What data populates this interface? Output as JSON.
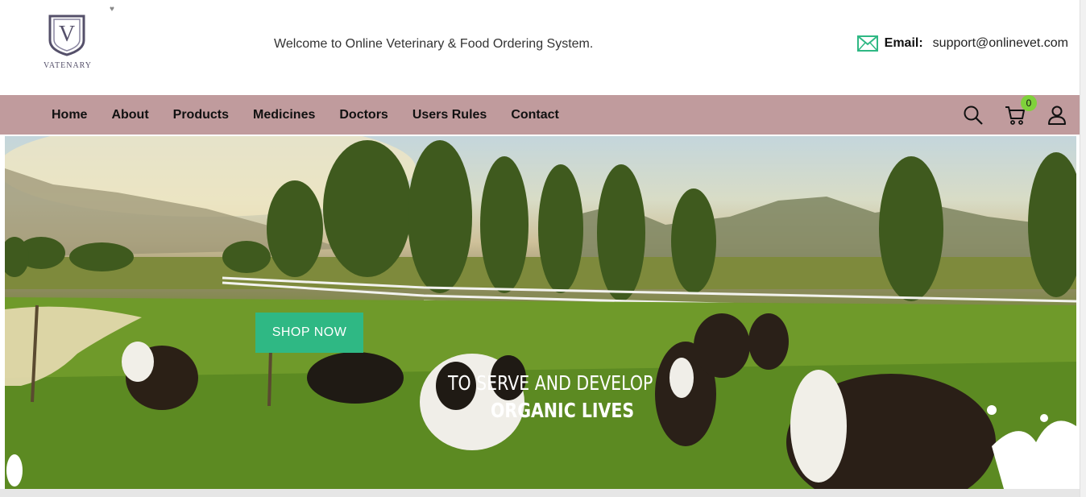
{
  "header": {
    "logo_text": "VATENARY",
    "logo_letter": "V",
    "welcome": "Welcome to Online Veterinary & Food Ordering System.",
    "email_label": "Email:",
    "email_value": "support@onlinevet.com"
  },
  "nav": {
    "items": [
      "Home",
      "About",
      "Products",
      "Medicines",
      "Doctors",
      "Users Rules",
      "Contact"
    ],
    "cart_count": "0"
  },
  "hero": {
    "button": "SHOP NOW",
    "line1": "TO SERVE AND DEVELOP",
    "line2": "ORGANIC LIVES"
  },
  "colors": {
    "nav_bg": "#c09b9d",
    "button_bg": "#2fb884",
    "badge_bg": "#7fd13b",
    "email_icon": "#2fb884"
  },
  "icons": [
    "envelope-icon",
    "search-icon",
    "cart-icon",
    "user-icon"
  ]
}
